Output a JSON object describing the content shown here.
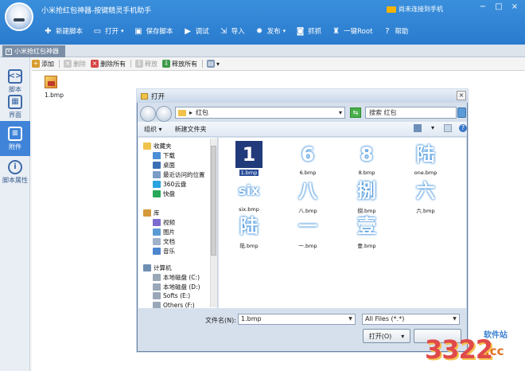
{
  "window": {
    "title": "小米抢红包神器-按键精灵手机助手",
    "notice": "尚未连接到手机",
    "controls": [
      "−",
      "□",
      "×"
    ]
  },
  "toolbar": {
    "items": [
      {
        "label": "新建脚本",
        "icon": "plus-icon"
      },
      {
        "label": "打开",
        "icon": "folder-icon",
        "caret": "▾"
      },
      {
        "label": "保存脚本",
        "icon": "save-icon"
      },
      {
        "label": "调试",
        "icon": "play-icon"
      },
      {
        "label": "导入",
        "icon": "import-icon"
      },
      {
        "label": "发布",
        "icon": "gear-icon",
        "caret": "▾"
      },
      {
        "label": "抓抓",
        "icon": "camera-icon"
      },
      {
        "label": "一键Root",
        "icon": "android-icon"
      },
      {
        "label": "帮助",
        "icon": "help-icon"
      }
    ]
  },
  "tab": {
    "label": "小米抢红包神器",
    "close": "×"
  },
  "leftnav": [
    {
      "label": "脚本",
      "glyph": "<>"
    },
    {
      "label": "界面",
      "glyph": "▦"
    },
    {
      "label": "附件",
      "glyph": "≡"
    },
    {
      "label": "脚本属性",
      "glyph": "i"
    }
  ],
  "subtoolbar": {
    "add": "添加",
    "delete": "删除",
    "delete_all": "删除所有",
    "release": "释放",
    "release_all": "释放所有",
    "view_caret": "▾"
  },
  "attachment": {
    "name": "1.bmp"
  },
  "dialog": {
    "title": "打开",
    "close": "×",
    "address": "红包",
    "address_caret": "▾",
    "search_placeholder": "搜索 红包",
    "organize": "组织 ▾",
    "new_folder": "新建文件夹",
    "tree": [
      {
        "label": "收藏夹",
        "color": "#f1c24b"
      },
      {
        "label": "下载",
        "color": "#4d8fd6"
      },
      {
        "label": "桌面",
        "color": "#3a6fb5"
      },
      {
        "label": "最近访问的位置",
        "color": "#7a9cc6"
      },
      {
        "label": "360云盘",
        "color": "#2aa3e0"
      },
      {
        "label": "快盘",
        "color": "#27a85a"
      },
      {
        "label": "库",
        "color": "#d49a3a"
      },
      {
        "label": "视频",
        "color": "#7b6bd0"
      },
      {
        "label": "图片",
        "color": "#5b9bd5"
      },
      {
        "label": "文档",
        "color": "#9fb2c9"
      },
      {
        "label": "音乐",
        "color": "#4c86cf"
      },
      {
        "label": "计算机",
        "color": "#6f8fb3"
      },
      {
        "label": "本地磁盘 (C:)",
        "color": "#9aa7b7"
      },
      {
        "label": "本地磁盘 (D:)",
        "color": "#9aa7b7"
      },
      {
        "label": "Softs (E:)",
        "color": "#9aa7b7"
      },
      {
        "label": "Others (F:)",
        "color": "#9aa7b7"
      }
    ],
    "files": [
      {
        "name": "1.bmp",
        "glyph": "1",
        "selected": true
      },
      {
        "name": "6.bmp",
        "glyph": "6"
      },
      {
        "name": "8.bmp",
        "glyph": "8"
      },
      {
        "name": "one.bmp",
        "glyph": "陆"
      },
      {
        "name": "six.bmp",
        "glyph": "six"
      },
      {
        "name": "八.bmp",
        "glyph": "八"
      },
      {
        "name": "捌.bmp",
        "glyph": "捌"
      },
      {
        "name": "六.bmp",
        "glyph": "六"
      },
      {
        "name": "陆.bmp",
        "glyph": "陆"
      },
      {
        "name": "一.bmp",
        "glyph": "一"
      },
      {
        "name": "壹.bmp",
        "glyph": "壹"
      }
    ],
    "filename_label": "文件名(N):",
    "filename_value": "1.bmp",
    "filter_value": "All Files (*.*)",
    "open_label": "打开(O)",
    "open_caret": "▾"
  },
  "watermark": {
    "number": "3322",
    "suffix": ".cc",
    "site": "软件站"
  }
}
